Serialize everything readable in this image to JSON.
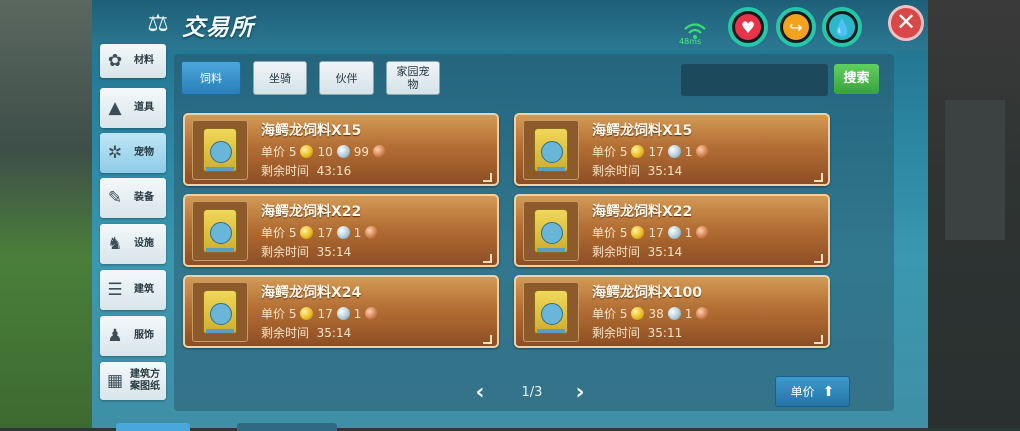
{
  "header": {
    "title": "交易所",
    "title_icon": "scales-icon",
    "ping": "48ms",
    "close_label": "✕"
  },
  "stats": [
    {
      "name": "health",
      "icon": "heart-icon",
      "color": "#e8344a"
    },
    {
      "name": "hunger",
      "icon": "food-icon",
      "color": "#f2a21c"
    },
    {
      "name": "water",
      "icon": "water-drop-icon",
      "color": "#2cb8c8"
    }
  ],
  "sidebar": {
    "items": [
      {
        "label": "材料",
        "icon": "cotton-icon"
      },
      {
        "label": "道具",
        "icon": "tool-icon"
      },
      {
        "label": "宠物",
        "icon": "paw-icon",
        "active": true
      },
      {
        "label": "装备",
        "icon": "equipment-icon"
      },
      {
        "label": "设施",
        "icon": "facility-icon"
      },
      {
        "label": "建筑",
        "icon": "building-icon"
      },
      {
        "label": "服饰",
        "icon": "clothing-icon"
      },
      {
        "label": "建筑方案图纸",
        "label_line1": "建筑方",
        "label_line2": "案图纸",
        "icon": "blueprint-icon"
      }
    ]
  },
  "tabs": [
    {
      "label": "饲料",
      "active": true
    },
    {
      "label": "坐骑"
    },
    {
      "label": "伙伴"
    },
    {
      "label": "家园宠物",
      "line1": "家园宠",
      "line2": "物"
    }
  ],
  "search": {
    "value": "",
    "button_label": "搜索"
  },
  "listings": [
    {
      "name": "海鳄龙饲料X15",
      "price_label": "单价",
      "gold": "5",
      "silver": "10",
      "copper": "99",
      "time_label": "剩余时间",
      "time": "43:16"
    },
    {
      "name": "海鳄龙饲料X15",
      "price_label": "单价",
      "gold": "5",
      "silver": "17",
      "copper": "1",
      "time_label": "剩余时间",
      "time": "35:14"
    },
    {
      "name": "海鳄龙饲料X22",
      "price_label": "单价",
      "gold": "5",
      "silver": "17",
      "copper": "1",
      "time_label": "剩余时间",
      "time": "35:14"
    },
    {
      "name": "海鳄龙饲料X22",
      "price_label": "单价",
      "gold": "5",
      "silver": "17",
      "copper": "1",
      "time_label": "剩余时间",
      "time": "35:14"
    },
    {
      "name": "海鳄龙饲料X24",
      "price_label": "单价",
      "gold": "5",
      "silver": "17",
      "copper": "1",
      "time_label": "剩余时间",
      "time": "35:14"
    },
    {
      "name": "海鳄龙饲料X100",
      "price_label": "单价",
      "gold": "5",
      "silver": "38",
      "copper": "1",
      "time_label": "剩余时间",
      "time": "35:11"
    }
  ],
  "pager": {
    "text": "1/3",
    "prev": "‹",
    "next": "›"
  },
  "sort": {
    "label": "单价",
    "arrow": "⬆"
  },
  "colors": {
    "panel": "#2a84a0",
    "card": "#b36f34",
    "accent_green": "#3aa23c",
    "accent_blue": "#2a7fb8"
  }
}
